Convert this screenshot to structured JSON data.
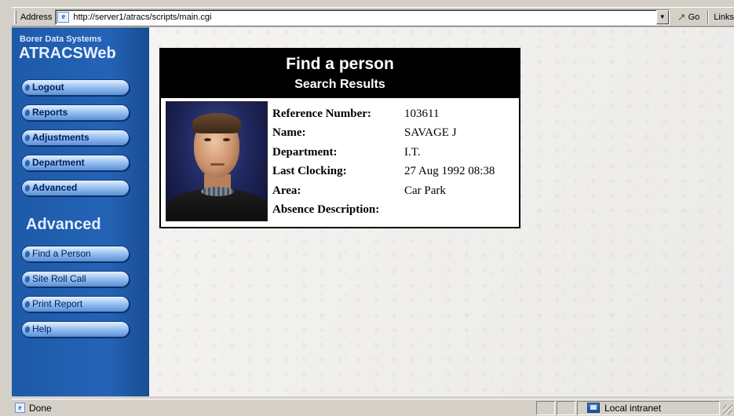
{
  "browser": {
    "address_label": "Address",
    "url": "http://server1/atracs/scripts/main.cgi",
    "go_label": "Go",
    "links_label": "Links",
    "status_text": "Done",
    "zone_text": "Local intranet"
  },
  "sidebar": {
    "brand_sub": "Borer Data Systems",
    "brand_main": "ATRACSWeb",
    "main_buttons": [
      "Logout",
      "Reports",
      "Adjustments",
      "Department",
      "Advanced"
    ],
    "section_title": "Advanced",
    "advanced_buttons": [
      "Find a Person",
      "Site Roll Call",
      "Print Report",
      "Help"
    ]
  },
  "result": {
    "title": "Find a person",
    "subtitle": "Search Results",
    "fields": [
      {
        "label": "Reference Number:",
        "value": "103611"
      },
      {
        "label": "Name:",
        "value": "SAVAGE J"
      },
      {
        "label": "Department:",
        "value": "I.T."
      },
      {
        "label": "Last Clocking:",
        "value": "27 Aug 1992 08:38"
      },
      {
        "label": "Area:",
        "value": "Car Park"
      },
      {
        "label": "Absence Description:",
        "value": ""
      }
    ]
  }
}
